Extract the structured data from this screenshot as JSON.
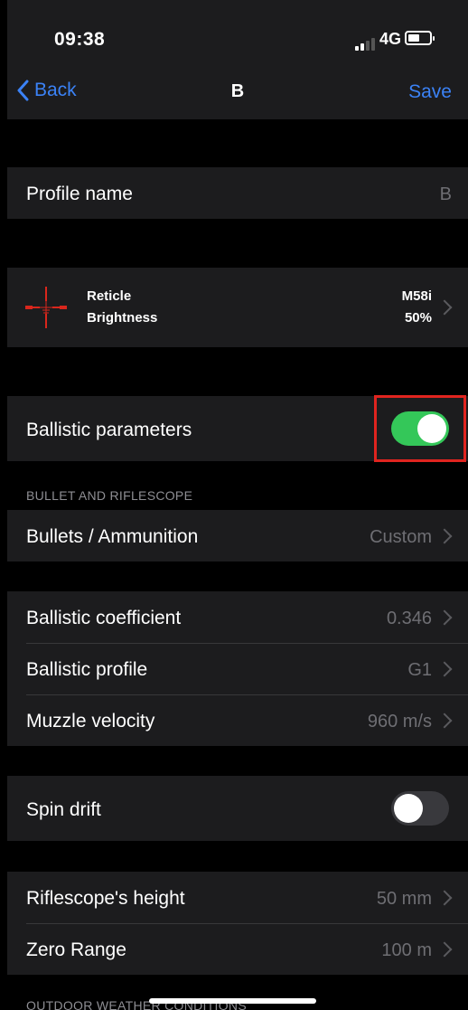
{
  "status_bar": {
    "time": "09:38",
    "network": "4G"
  },
  "nav": {
    "back_label": "Back",
    "title": "B",
    "save_label": "Save"
  },
  "profile_name": {
    "label": "Profile name",
    "value": "B"
  },
  "reticle": {
    "label_reticle": "Reticle",
    "label_brightness": "Brightness",
    "reticle_value": "M58i",
    "brightness_value": "50%",
    "icon_color": "#d9261c"
  },
  "ballistic_parameters": {
    "label": "Ballistic parameters",
    "enabled": true
  },
  "sections": {
    "bullet_and_riflescope": "BULLET AND RIFLESCOPE",
    "outdoor_weather": "OUTDOOR WEATHER CONDITIONS"
  },
  "bullets": {
    "label": "Bullets / Ammunition",
    "value": "Custom"
  },
  "ballistics": [
    {
      "label": "Ballistic coefficient",
      "value": "0.346"
    },
    {
      "label": "Ballistic profile",
      "value": "G1"
    },
    {
      "label": "Muzzle velocity",
      "value": "960 m/s"
    }
  ],
  "spin_drift": {
    "label": "Spin drift",
    "enabled": false
  },
  "riflescope": [
    {
      "label": "Riflescope's height",
      "value": "50 mm"
    },
    {
      "label": "Zero Range",
      "value": "100 m"
    }
  ],
  "colors": {
    "accent": "#3b82f6",
    "toggle_on": "#34c759",
    "toggle_off": "#39393d",
    "highlight": "#e0241f"
  }
}
